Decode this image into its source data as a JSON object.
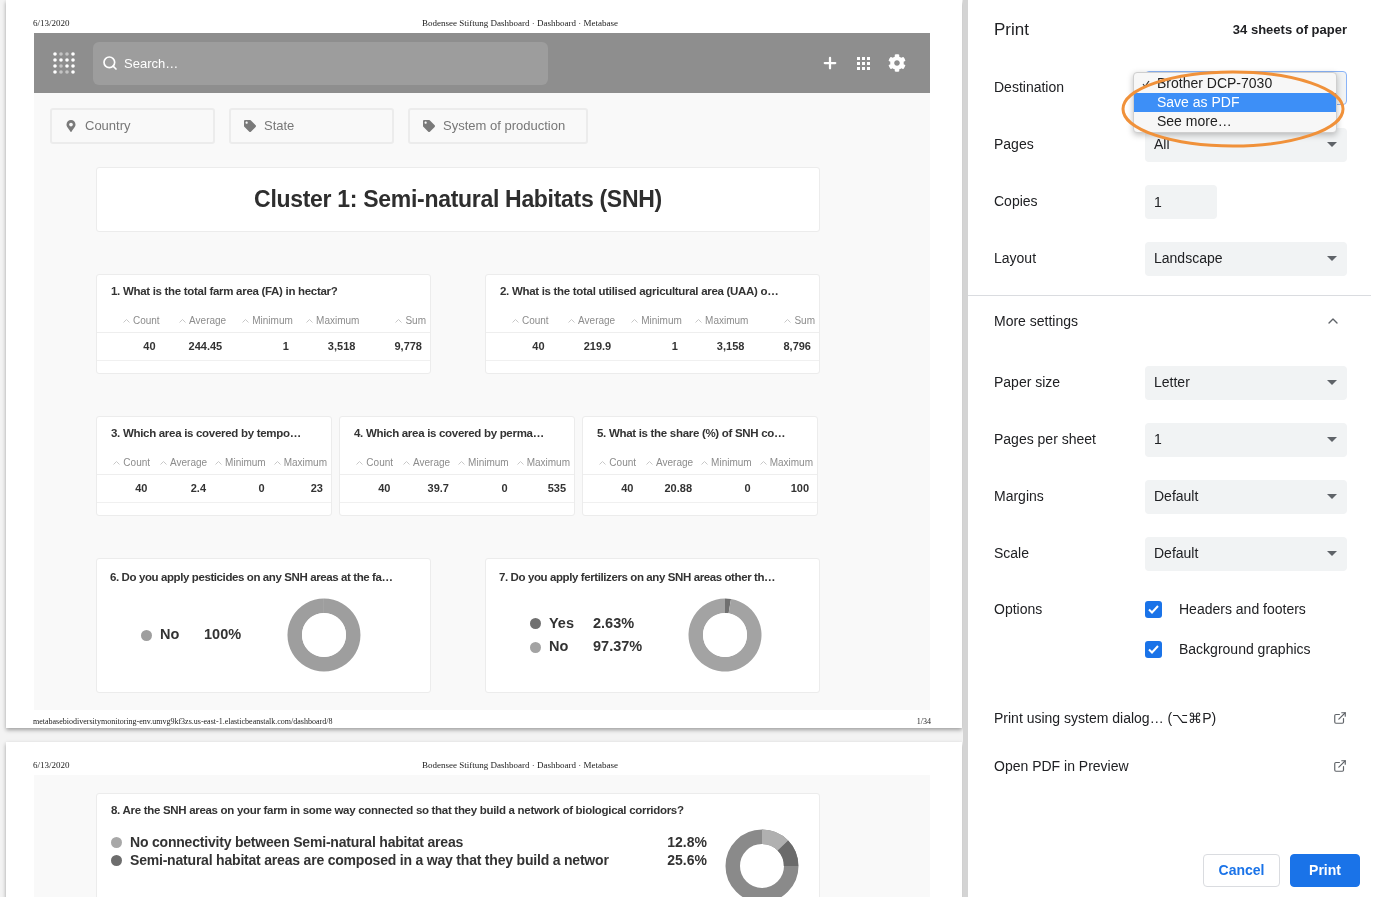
{
  "page1": {
    "header": {
      "date": "6/13/2020",
      "title": "Bodensee Stiftung Dashboard · Dashboard · Metabase"
    },
    "navbar": {
      "search_placeholder": "Search…"
    },
    "filters": [
      {
        "label": "Country"
      },
      {
        "label": "State"
      },
      {
        "label": "System of production"
      }
    ],
    "heading": "Cluster 1: Semi-natural Habitats (SNH)",
    "table_card_rows": [
      [
        {
          "title": "1. What is the total farm area (FA) in hectar?",
          "columns": [
            "Count",
            "Average",
            "Minimum",
            "Maximum",
            "Sum"
          ],
          "values": [
            "40",
            "244.45",
            "1",
            "3,518",
            "9,778"
          ]
        },
        {
          "title": "2. What is the total utilised agricultural area (UAA) o…",
          "columns": [
            "Count",
            "Average",
            "Minimum",
            "Maximum",
            "Sum"
          ],
          "values": [
            "40",
            "219.9",
            "1",
            "3,158",
            "8,796"
          ]
        }
      ],
      [
        {
          "title": "3. Which area is covered by tempo…",
          "columns": [
            "Count",
            "Average",
            "Minimum",
            "Maximum"
          ],
          "values": [
            "40",
            "2.4",
            "0",
            "23"
          ]
        },
        {
          "title": "4. Which area is covered by perma…",
          "columns": [
            "Count",
            "Average",
            "Minimum",
            "Maximum"
          ],
          "values": [
            "40",
            "39.7",
            "0",
            "535"
          ]
        },
        {
          "title": "5. What is the share (%) of SNH co…",
          "columns": [
            "Count",
            "Average",
            "Minimum",
            "Maximum"
          ],
          "values": [
            "40",
            "20.88",
            "0",
            "100"
          ]
        }
      ]
    ],
    "donut_cards": [
      {
        "title": "6. Do you apply pesticides on any SNH areas at the fa…",
        "legend": [
          {
            "value": "100%",
            "color": "#9e9e9e"
          }
        ],
        "chart_data": {
          "type": "donut",
          "categories": [
            "No"
          ],
          "values": [
            100
          ]
        }
      },
      {
        "title": "7. Do you apply fertilizers on any SNH areas other th…",
        "legend": [
          {
            "value": "2.63%",
            "color": "#707070"
          },
          {
            "value": "97.37%",
            "color": "#a3a3a3"
          }
        ],
        "chart_data": {
          "type": "donut",
          "categories": [
            "Yes",
            "No"
          ],
          "values": [
            2.63,
            97.37
          ]
        }
      }
    ],
    "footer": {
      "url": "metabasebiodiversitymonitoring-env.umvg9kf3zs.us-east-1.elasticbeanstalk.com/dashboard/8",
      "page": "1/34"
    }
  },
  "page2": {
    "header": {
      "date": "6/13/2020",
      "title": "Bodensee Stiftung Dashboard · Dashboard · Metabase"
    },
    "card": {
      "title": "8. Are the SNH areas on your farm in some way connected so that they build a network of biological corridors?",
      "legend": [
        {
          "label": "No connectivity between Semi-natural habitat areas",
          "value": "12.8%",
          "color": "#a8a8a8"
        },
        {
          "label": "Semi-natural habitat areas are composed in a way that they build a networ",
          "value": "25.6%",
          "color": "#6d6d6d"
        }
      ]
    }
  },
  "print_panel": {
    "title": "Print",
    "sheets": "34 sheets of paper",
    "settings": [
      {
        "kind": "select",
        "label": "Destination",
        "focused": true
      },
      {
        "kind": "select",
        "label": "Pages",
        "value": "All"
      },
      {
        "kind": "input",
        "label": "Copies",
        "value": "1"
      },
      {
        "kind": "select",
        "label": "Layout",
        "value": "Landscape"
      }
    ],
    "destination_menu": {
      "open": true,
      "options": [
        {
          "label": "Brother DCP-7030",
          "checked": true,
          "selected": false
        },
        {
          "label": "Save as PDF",
          "checked": false,
          "selected": true
        },
        {
          "label": "See more…",
          "checked": false,
          "selected": false
        }
      ]
    },
    "more_settings": {
      "label": "More settings",
      "expanded": true,
      "settings": [
        {
          "kind": "select",
          "label": "Paper size",
          "value": "Letter"
        },
        {
          "kind": "select",
          "label": "Pages per sheet",
          "value": "1"
        },
        {
          "kind": "select",
          "label": "Margins",
          "value": "Default"
        },
        {
          "kind": "select",
          "label": "Scale",
          "value": "Default"
        }
      ],
      "options_label": "Options",
      "options": [
        {
          "label": "Headers and footers",
          "checked": true
        },
        {
          "label": "Background graphics",
          "checked": true
        }
      ]
    },
    "links": [
      "Print using system dialog… (⌥⌘P)",
      "Open PDF in Preview"
    ],
    "buttons": [
      {
        "kind": "secondary",
        "label": "Cancel"
      },
      {
        "kind": "primary",
        "label": "Print"
      }
    ]
  }
}
